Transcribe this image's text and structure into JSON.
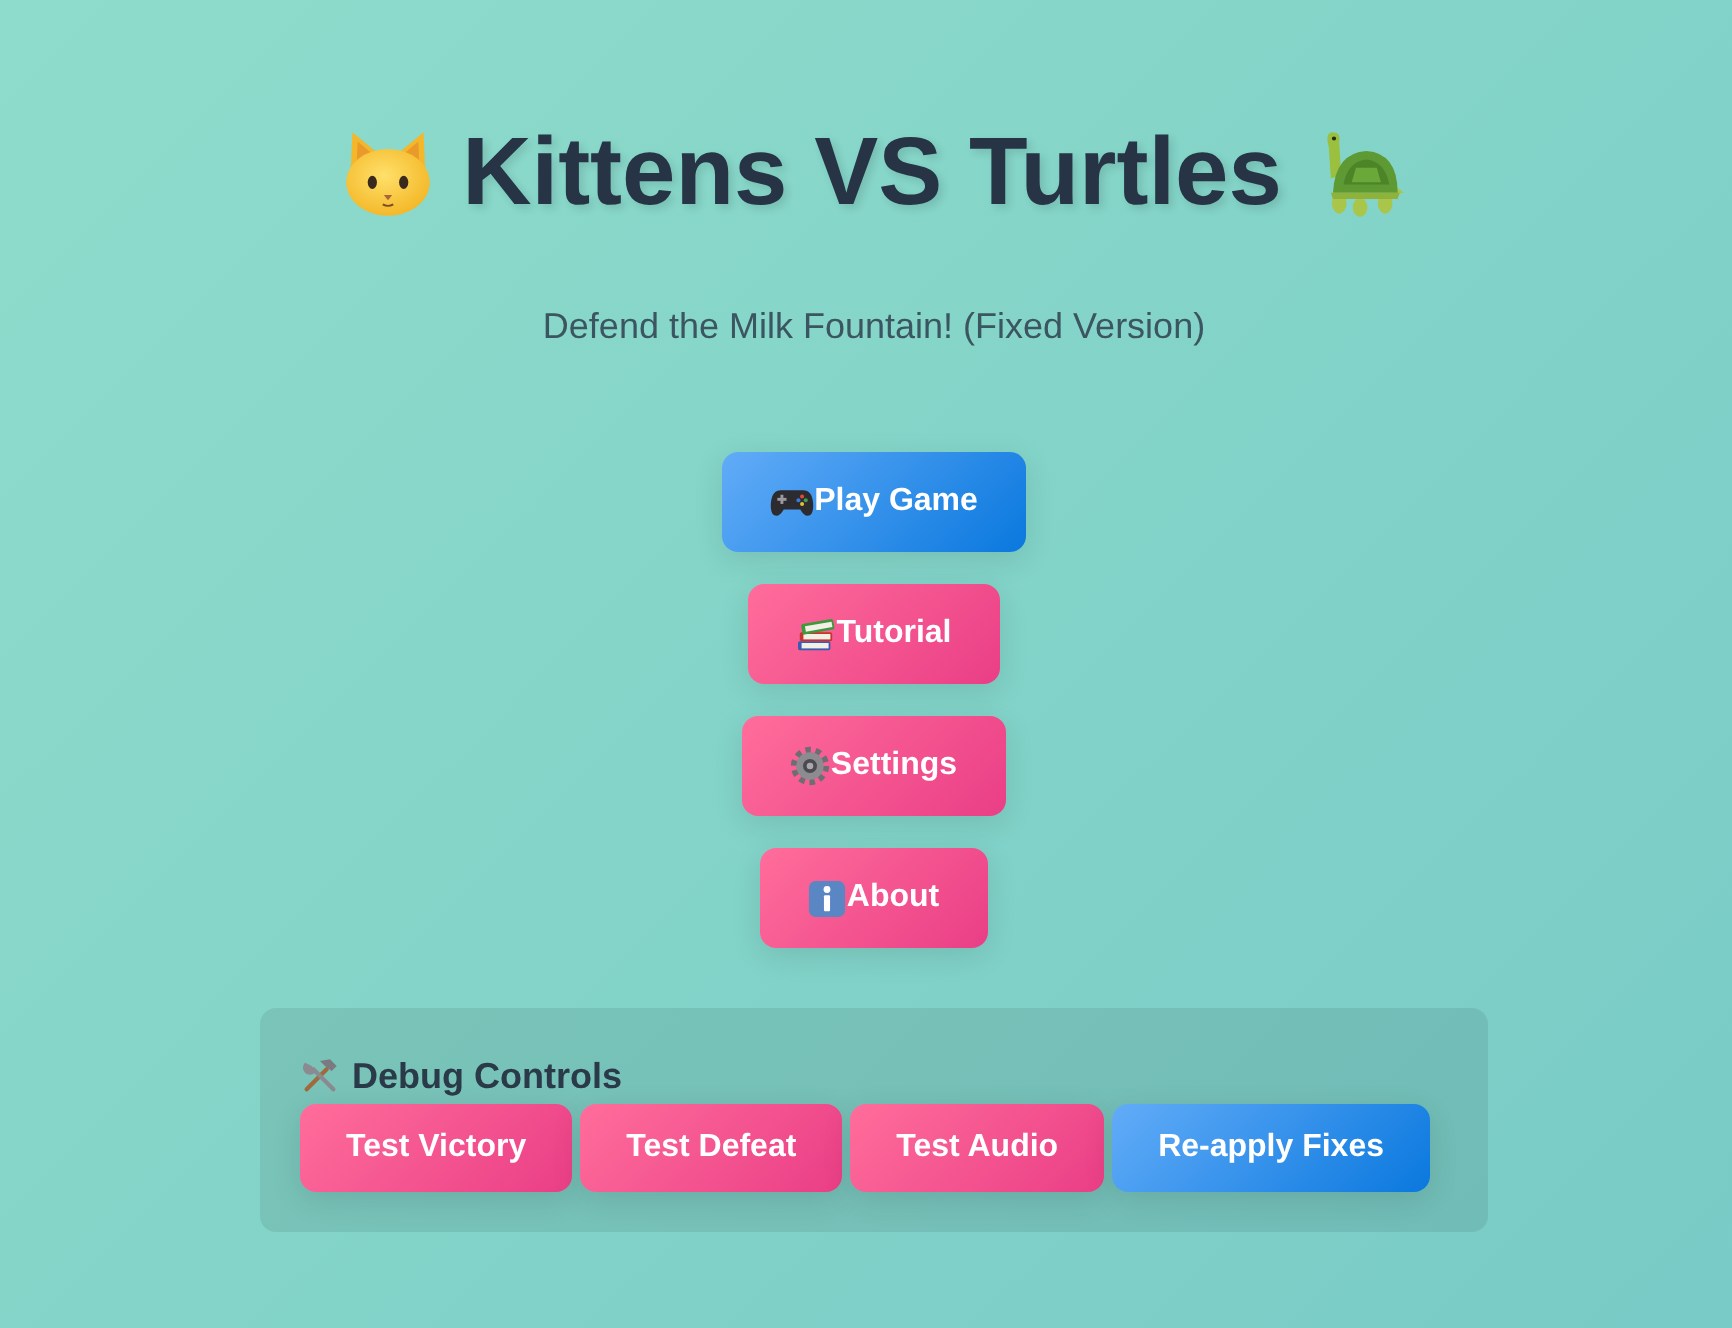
{
  "title": {
    "text": "Kittens VS Turtles"
  },
  "subtitle": "Defend the Milk Fountain! (Fixed Version)",
  "menu": [
    {
      "label": "Play Game",
      "kind": "primary"
    },
    {
      "label": "Tutorial",
      "kind": "secondary"
    },
    {
      "label": "Settings",
      "kind": "secondary"
    },
    {
      "label": "About",
      "kind": "secondary"
    }
  ],
  "debug": {
    "heading": "Debug Controls",
    "buttons": [
      {
        "label": "Test Victory",
        "kind": "secondary"
      },
      {
        "label": "Test Defeat",
        "kind": "secondary"
      },
      {
        "label": "Test Audio",
        "kind": "secondary"
      },
      {
        "label": "Re-apply Fixes",
        "kind": "primary"
      }
    ]
  }
}
